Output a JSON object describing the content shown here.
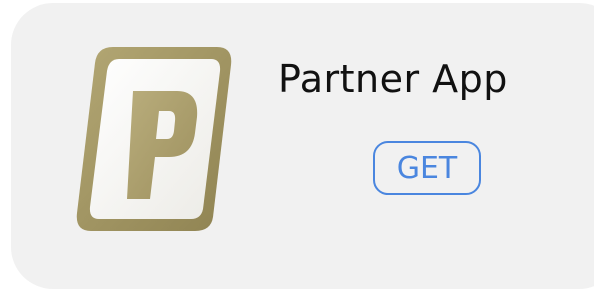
{
  "app": {
    "name": "Partner App",
    "icon": {
      "name": "partner-app-p-logo-icon",
      "letter": "P",
      "colors": {
        "frame": "#a89a68",
        "frame_shade": "#857848",
        "face": "#ffffff",
        "letter": "#b1a574"
      }
    }
  },
  "actions": {
    "get_label": "GET",
    "accent_color": "#4a86df"
  }
}
